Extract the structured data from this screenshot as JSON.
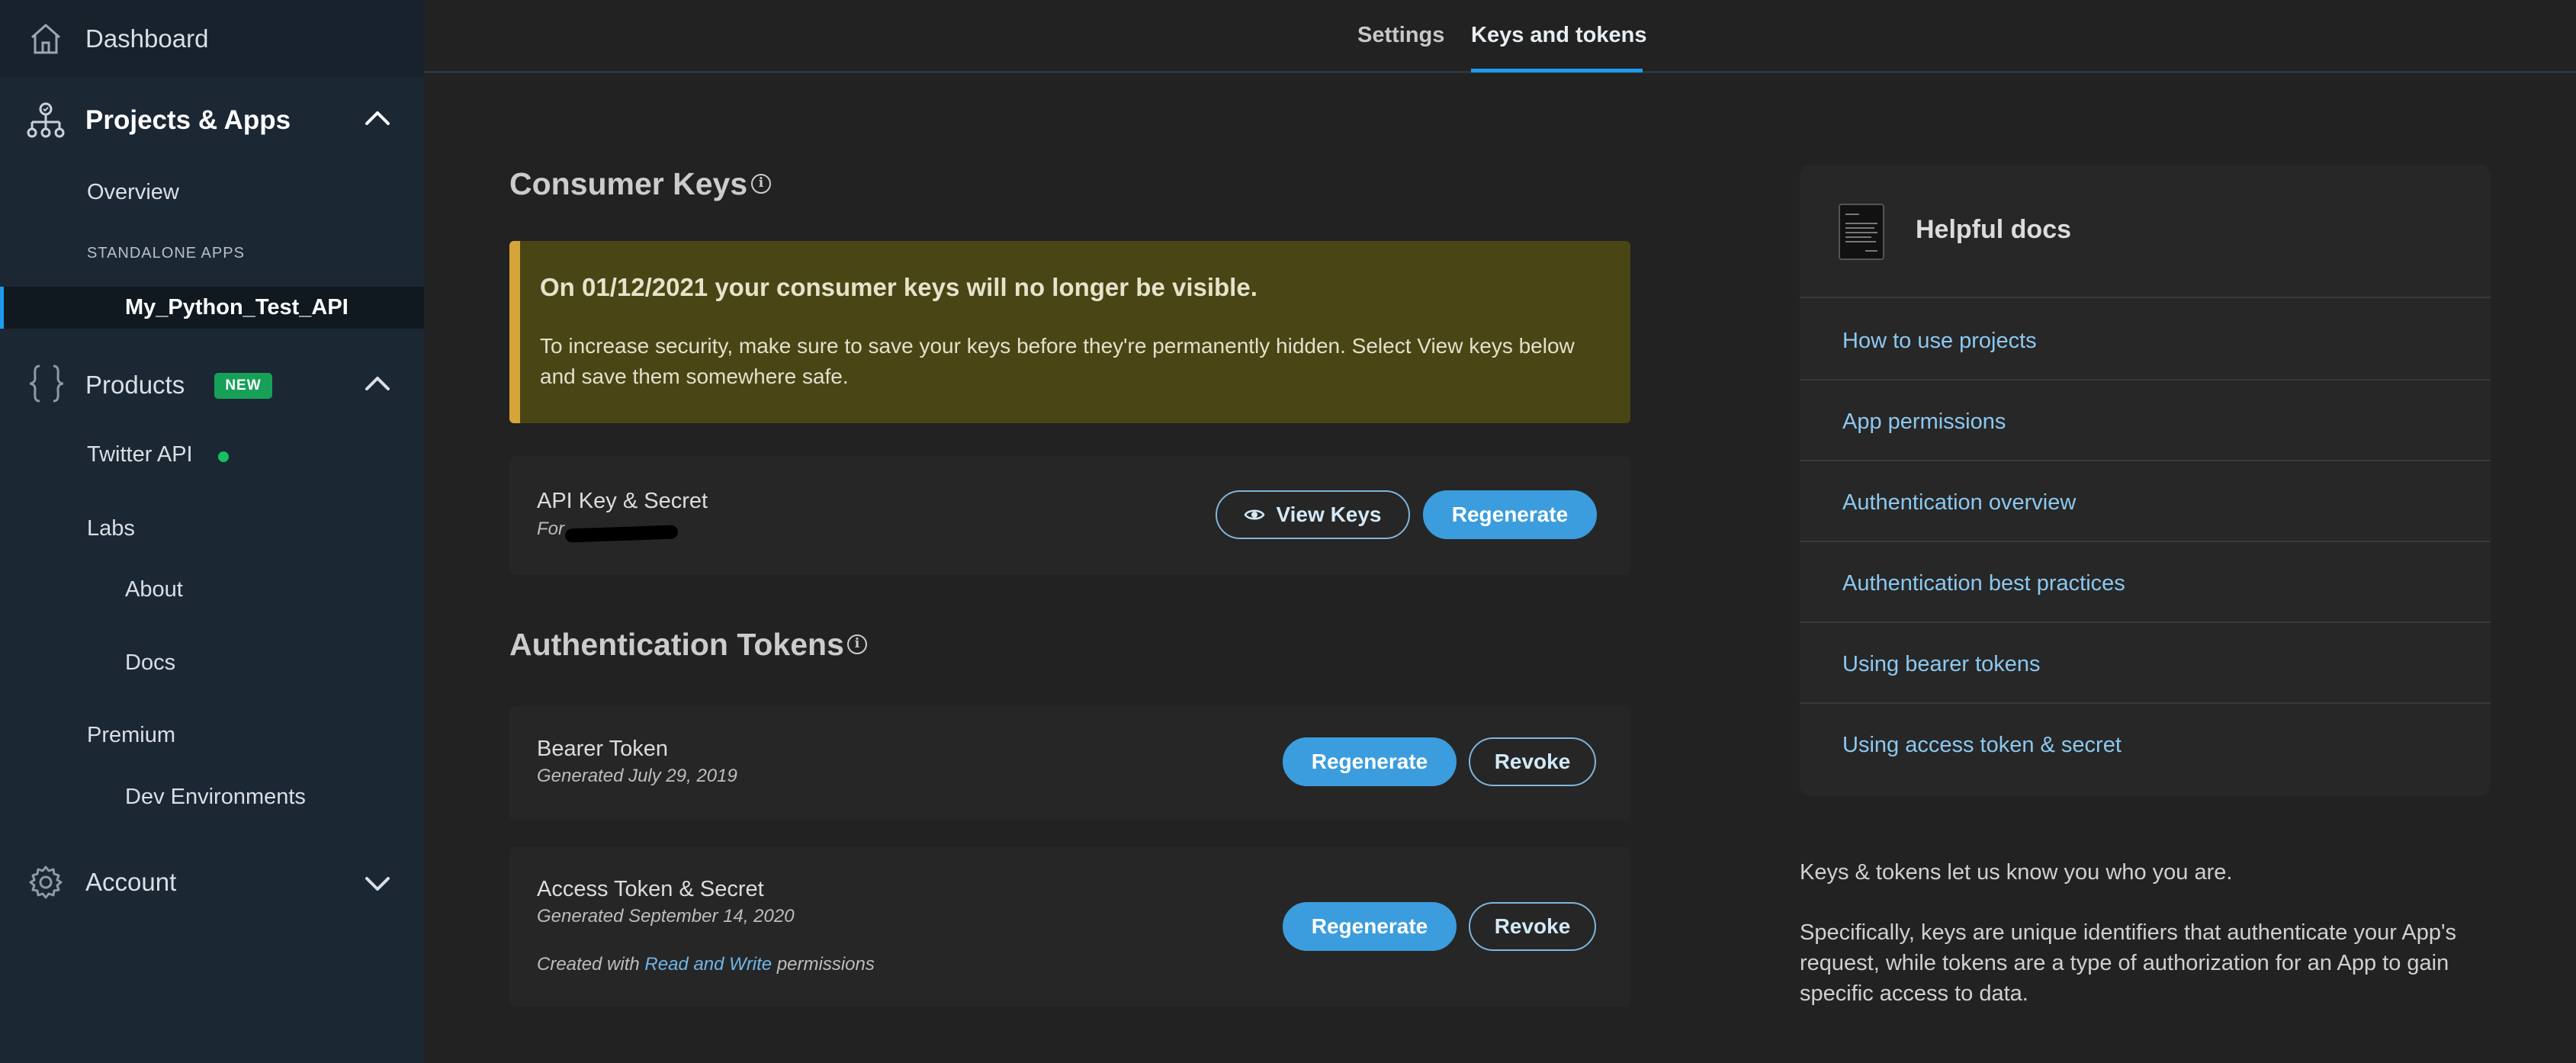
{
  "sidebar": {
    "dashboard": "Dashboard",
    "projects_apps": "Projects & Apps",
    "overview": "Overview",
    "standalone_caption": "STANDALONE APPS",
    "active_app": "My_Python_Test_API",
    "products": "Products",
    "new_badge": "NEW",
    "twitter_api": "Twitter API",
    "labs": "Labs",
    "about": "About",
    "docs": "Docs",
    "premium": "Premium",
    "dev_environments": "Dev Environments",
    "account": "Account"
  },
  "tabs": {
    "settings": "Settings",
    "keys_tokens": "Keys and tokens",
    "active": "Keys and tokens"
  },
  "consumer": {
    "title": "Consumer Keys",
    "alert_title": "On 01/12/2021 your consumer keys will no longer be visible.",
    "alert_body": "To increase security, make sure to save your keys before they're permanently hidden. Select View keys below and save them somewhere safe.",
    "api_key_title": "API Key & Secret",
    "api_key_for": "For",
    "view_keys": "View Keys",
    "regenerate": "Regenerate"
  },
  "auth": {
    "title": "Authentication Tokens",
    "bearer_title": "Bearer Token",
    "bearer_generated": "Generated July 29, 2019",
    "access_title": "Access Token & Secret",
    "access_generated": "Generated September 14, 2020",
    "created_prefix": "Created with",
    "created_link": "Read and Write",
    "created_suffix": "permissions",
    "regenerate": "Regenerate",
    "revoke": "Revoke"
  },
  "docs": {
    "title": "Helpful docs",
    "links": [
      "How to use projects",
      "App permissions",
      "Authentication overview",
      "Authentication best practices",
      "Using bearer tokens",
      "Using access token & secret"
    ]
  },
  "info": {
    "line1": "Keys & tokens let us know you who you are.",
    "line2": "Specifically, keys are unique identifiers that authenticate your App's request, while tokens are a type of authorization for an App to gain specific access to data."
  },
  "colors": {
    "accent": "#1d9bf0",
    "button_fill": "#3b9ddd",
    "alert_bg": "#4a4514",
    "alert_stripe": "#d6a53a",
    "new_badge": "#17a058",
    "link": "#8cc8f0"
  },
  "icons": {
    "dashboard": "home-icon",
    "projects": "sitemap-icon",
    "products": "curly-braces-icon",
    "account": "gear-icon",
    "docs": "document-icon",
    "view_keys": "eye-icon",
    "info": "info-icon"
  }
}
